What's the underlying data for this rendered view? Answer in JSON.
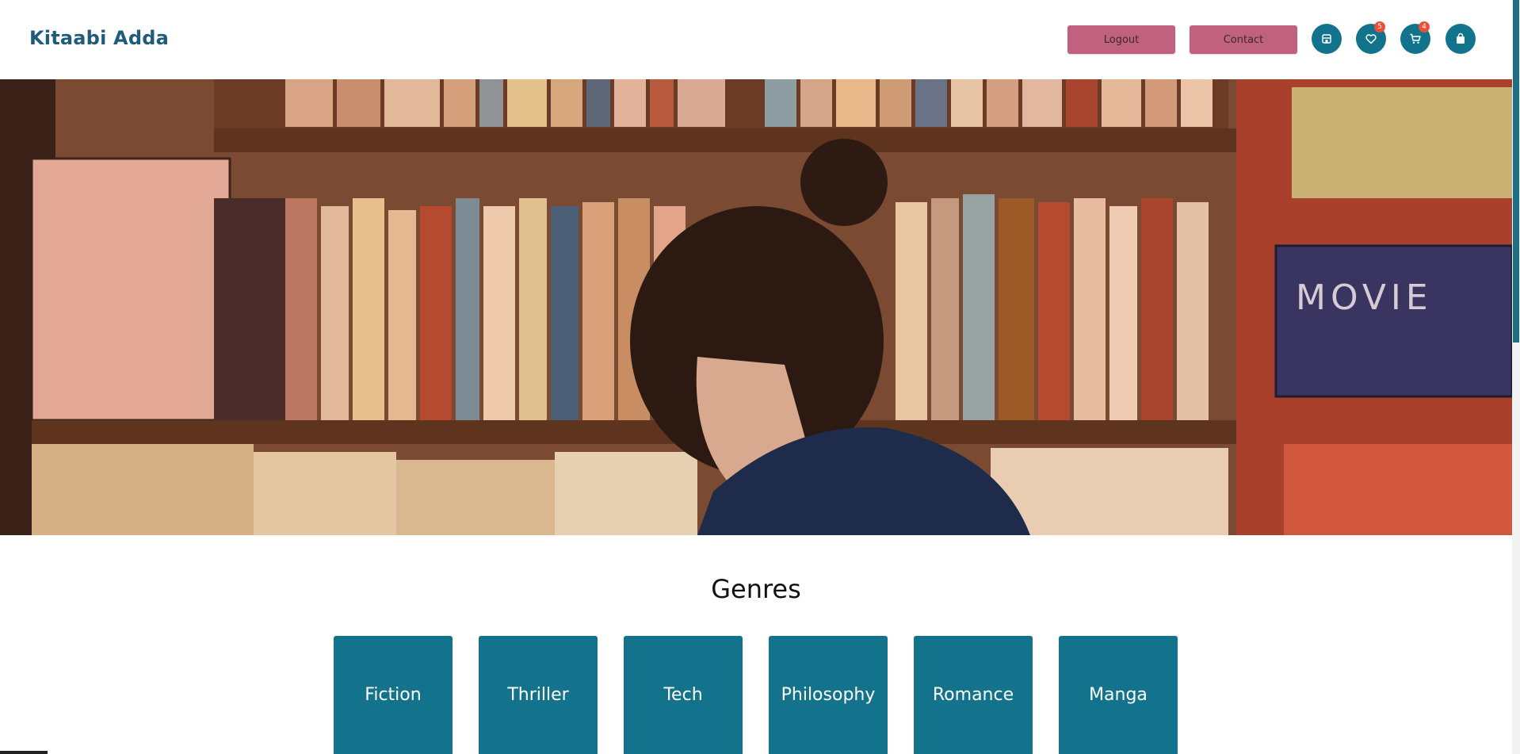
{
  "header": {
    "brand": "Kitaabi Adda",
    "logout_label": "Logout",
    "contact_label": "Contact",
    "icons": [
      {
        "name": "store-icon",
        "badge": null
      },
      {
        "name": "heart-icon",
        "badge": "5"
      },
      {
        "name": "cart-icon",
        "badge": "4"
      },
      {
        "name": "bag-icon",
        "badge": null
      }
    ]
  },
  "hero": {
    "shelf_sign": "MOVIE"
  },
  "genres": {
    "title": "Genres",
    "items": [
      "Fiction",
      "Thriller",
      "Tech",
      "Philosophy",
      "Romance",
      "Manga"
    ]
  },
  "colors": {
    "brand": "#1f5b7a",
    "accent_button": "#c0617f",
    "teal": "#13738d",
    "badge": "#e8503a"
  }
}
